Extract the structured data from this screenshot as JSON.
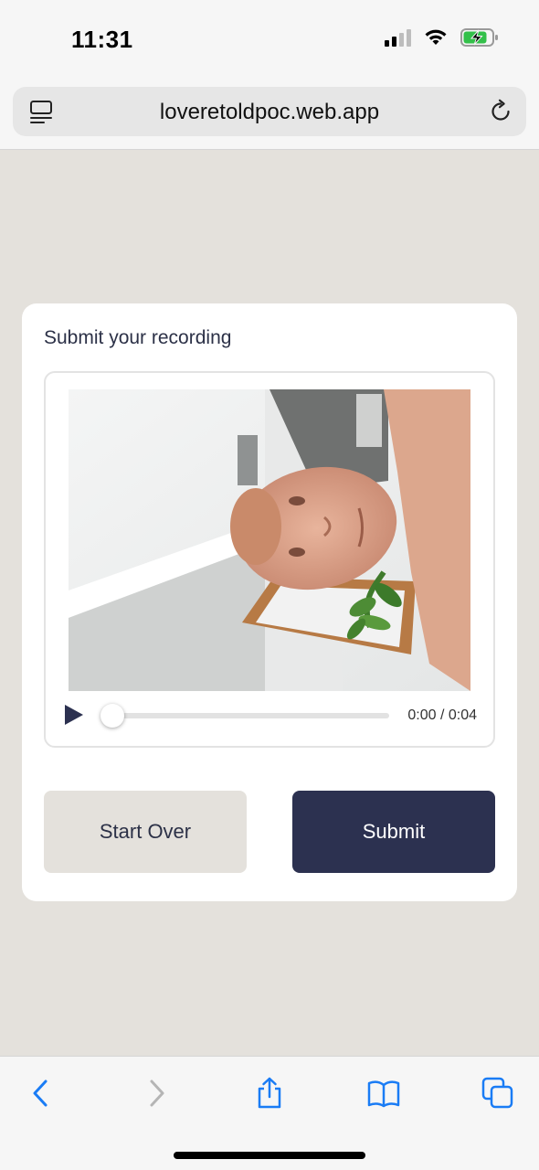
{
  "status_bar": {
    "time": "11:31",
    "icons": [
      "cellular-signal-icon",
      "wifi-icon",
      "battery-charging-icon"
    ],
    "battery_color": "#33c04a"
  },
  "browser": {
    "url": "loveretoldpoc.web.app",
    "accent_color": "#1a7cf5"
  },
  "card": {
    "title": "Submit your recording",
    "player": {
      "time_readout": "0:00 / 0:04",
      "progress": 0
    },
    "start_over_label": "Start Over",
    "submit_label": "Submit",
    "submit_color": "#2c3150",
    "start_over_color": "#e4e1dc"
  },
  "toolbar": {
    "icons": [
      "back-icon",
      "forward-icon",
      "share-icon",
      "bookmarks-icon",
      "tabs-icon"
    ]
  }
}
